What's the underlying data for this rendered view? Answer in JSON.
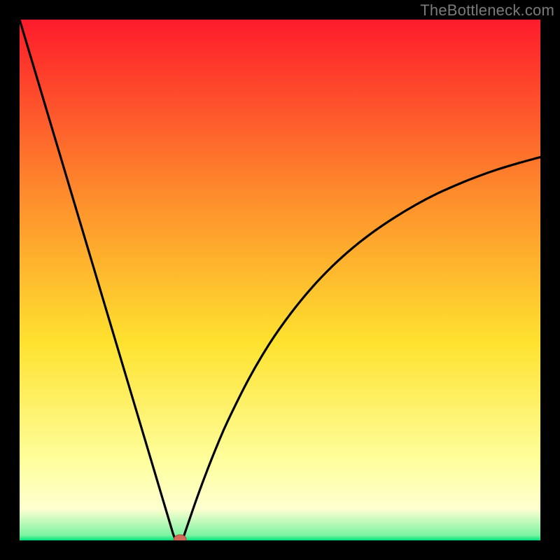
{
  "watermark": "TheBottleneck.com",
  "colors": {
    "frame": "#000000",
    "grad_top": "#fe1b2b",
    "grad_mid1": "#fe8d2c",
    "grad_mid2": "#fee22f",
    "grad_low": "#feff9e",
    "grad_bottom": "#00e27b",
    "curve": "#000000",
    "marker_fill": "#d16a56",
    "marker_stroke": "#a94e3e"
  },
  "chart_data": {
    "type": "line",
    "title": "",
    "xlabel": "",
    "ylabel": "",
    "xlim": [
      0,
      100
    ],
    "ylim": [
      0,
      100
    ],
    "x": [
      0,
      2,
      4,
      6,
      8,
      10,
      12,
      14,
      16,
      18,
      20,
      22,
      24,
      26,
      27,
      28,
      29,
      29.5,
      30,
      30.5,
      31,
      31.5,
      32,
      34,
      36,
      38,
      40,
      44,
      48,
      52,
      56,
      60,
      64,
      68,
      72,
      76,
      80,
      84,
      88,
      92,
      96,
      100
    ],
    "y": [
      100,
      93.3,
      86.6,
      79.9,
      73.2,
      66.5,
      59.8,
      53.1,
      46.4,
      39.7,
      33.0,
      26.3,
      19.6,
      12.9,
      9.55,
      6.2,
      2.85,
      1.2,
      0.1,
      0.1,
      0.1,
      0.8,
      2.2,
      8.0,
      13.4,
      18.4,
      23.0,
      31.0,
      37.8,
      43.5,
      48.4,
      52.6,
      56.2,
      59.3,
      62.0,
      64.4,
      66.5,
      68.3,
      69.9,
      71.3,
      72.5,
      73.6
    ],
    "marker": {
      "x": 30.8,
      "y": 0.15
    },
    "notes": "V-shaped bottleneck curve; y is percent mismatch (0 = optimal). Minimum near x≈31. Values estimated from pixels."
  }
}
